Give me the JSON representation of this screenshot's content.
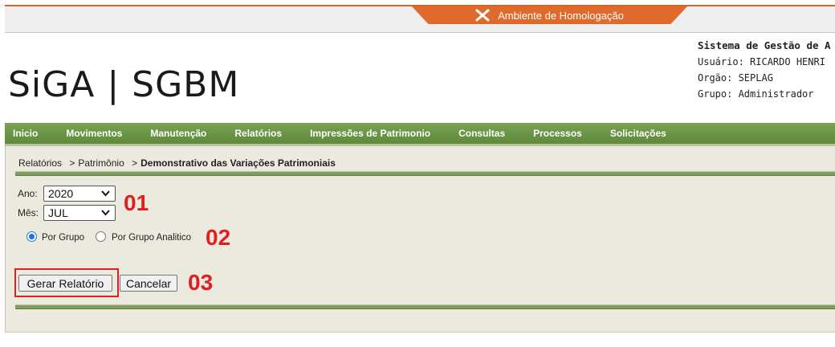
{
  "environment": {
    "label": "Ambiente de Homologação",
    "color": "#e06a2c",
    "icon": "tools-icon"
  },
  "logo": {
    "text": "SiGA | SGBM"
  },
  "user_info": {
    "system": "Sistema de Gestão de A",
    "usuario": "Usuário: RICARDO HENRI",
    "orgao": "Orgão: SEPLAG",
    "grupo": "Grupo: Administrador"
  },
  "menu": {
    "color": "#6b9546",
    "items": [
      "Inicio",
      "Movimentos",
      "Manutenção",
      "Relatórios",
      "Impressões de Patrimonio",
      "Consultas",
      "Processos",
      "Solicitações"
    ]
  },
  "breadcrumb": {
    "items": [
      "Relatórios",
      "Patrimônio"
    ],
    "current": "Demonstrativo das Variações Patrimoniais",
    "separator": ">"
  },
  "form": {
    "ano_label": "Ano:",
    "ano_value": "2020",
    "mes_label": "Mês:",
    "mes_value": "JUL",
    "radio_grupo": "Por Grupo",
    "radio_analitico": "Por Grupo Analitico",
    "selected_radio": "Por Grupo",
    "gerar_button": "Gerar Relatório",
    "cancelar_button": "Cancelar"
  },
  "annotations": {
    "n1": "01",
    "n2": "02",
    "n3": "03",
    "color": "#e02020"
  }
}
